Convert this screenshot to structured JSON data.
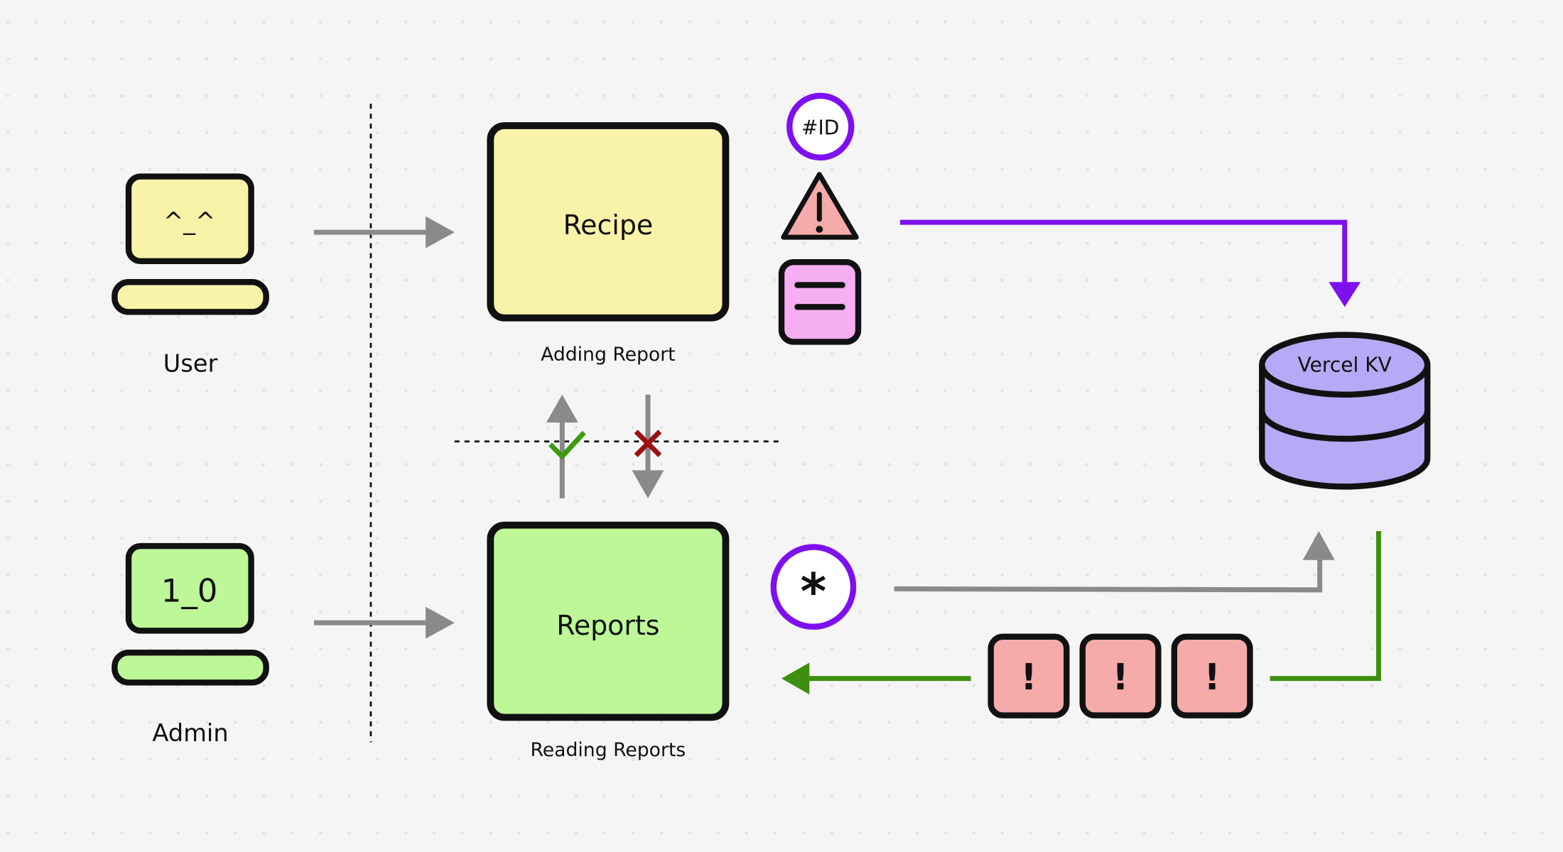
{
  "actors": {
    "user": {
      "label": "User",
      "screen_text": "^_^",
      "color": "#f8f3a9"
    },
    "admin": {
      "label": "Admin",
      "screen_text": "1_0",
      "color": "#bdf798"
    }
  },
  "boxes": {
    "recipe": {
      "title": "Recipe",
      "caption": "Adding Report",
      "color": "#f8f3a9"
    },
    "reports": {
      "title": "Reports",
      "caption": "Reading Reports",
      "color": "#bdf798"
    }
  },
  "badges": {
    "id": "#ID",
    "warning": "!",
    "asterisk": "*",
    "errors": [
      "!",
      "!",
      "!"
    ]
  },
  "database": {
    "label": "Vercel KV",
    "color": "#b4aaf5"
  },
  "colors": {
    "purple_flow": "#7f10ee",
    "green_flow": "#3e8f10",
    "gray_flow": "#8a8a8a",
    "allowed_check": "#3e9a10",
    "blocked_x": "#9b1010",
    "error_fill": "#f6abab",
    "doc_fill": "#f6aef3",
    "background": "#f5f5f5"
  }
}
